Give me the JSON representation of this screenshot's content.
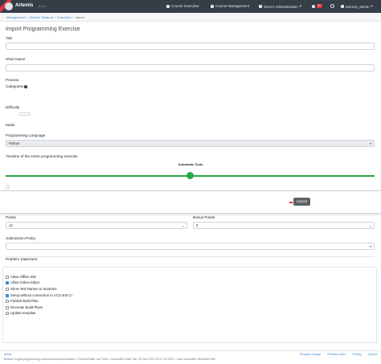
{
  "navbar": {
    "brand": "Artemis",
    "version": "4.4.4",
    "course_overview": "Course Overview",
    "course_management": "Course Management",
    "server_admin": "Server Administration",
    "badge": "5+",
    "user": "artemis_admin"
  },
  "breadcrumb": [
    "Management",
    "Artemis Testkurs",
    "Exercises",
    "Import"
  ],
  "page": {
    "title": "Import Programming Exercise",
    "title_label": "Title",
    "short_name_label": "Short Name",
    "preview_label": "Preview",
    "categories_label": "Categories",
    "difficulty_label": "Difficulty",
    "mode_label": "Mode",
    "language_label": "Programming Language",
    "language_value": "Python",
    "timeline_label": "Timeline of the entire programming exercise",
    "timeline_head": "Automatic Tests"
  },
  "modal": {
    "cancel": "Cancel",
    "more": "..."
  },
  "grading": {
    "points_label": "Points",
    "points_value": "12",
    "bonus_label": "Bonus Points",
    "bonus_value": "0",
    "submission_policy_label": "Submission Policy",
    "problem_statement_label": "Problem Statement"
  },
  "options": [
    {
      "label": "Allow Offline IDE",
      "checked": false
    },
    {
      "label": "Allow Online Editor",
      "checked": true
    },
    {
      "label": "Show Test Names to Students",
      "checked": false
    },
    {
      "label": "Setup without connection to VCS and CI",
      "checked": true
    },
    {
      "label": "Publish Build Plan",
      "checked": false
    },
    {
      "label": "Recreate Build Plans",
      "checked": false
    },
    {
      "label": "Update template",
      "checked": false
    }
  ],
  "footer": {
    "about": "About",
    "branch": "Branch: bugfix/programming-exercises/read-permission • Commit Hash: ae77e9b • Committer Date: Sat, 10 Dec 2022 15:37:15 GMT • Last Committer: Benedikt Hein",
    "links": [
      "Request change",
      "Release notes",
      "Privacy",
      "Imprint"
    ]
  },
  "colors": {
    "navbar": "#353d47",
    "primary": "#3e8acc",
    "success": "#28a745",
    "danger": "#dc3545"
  }
}
